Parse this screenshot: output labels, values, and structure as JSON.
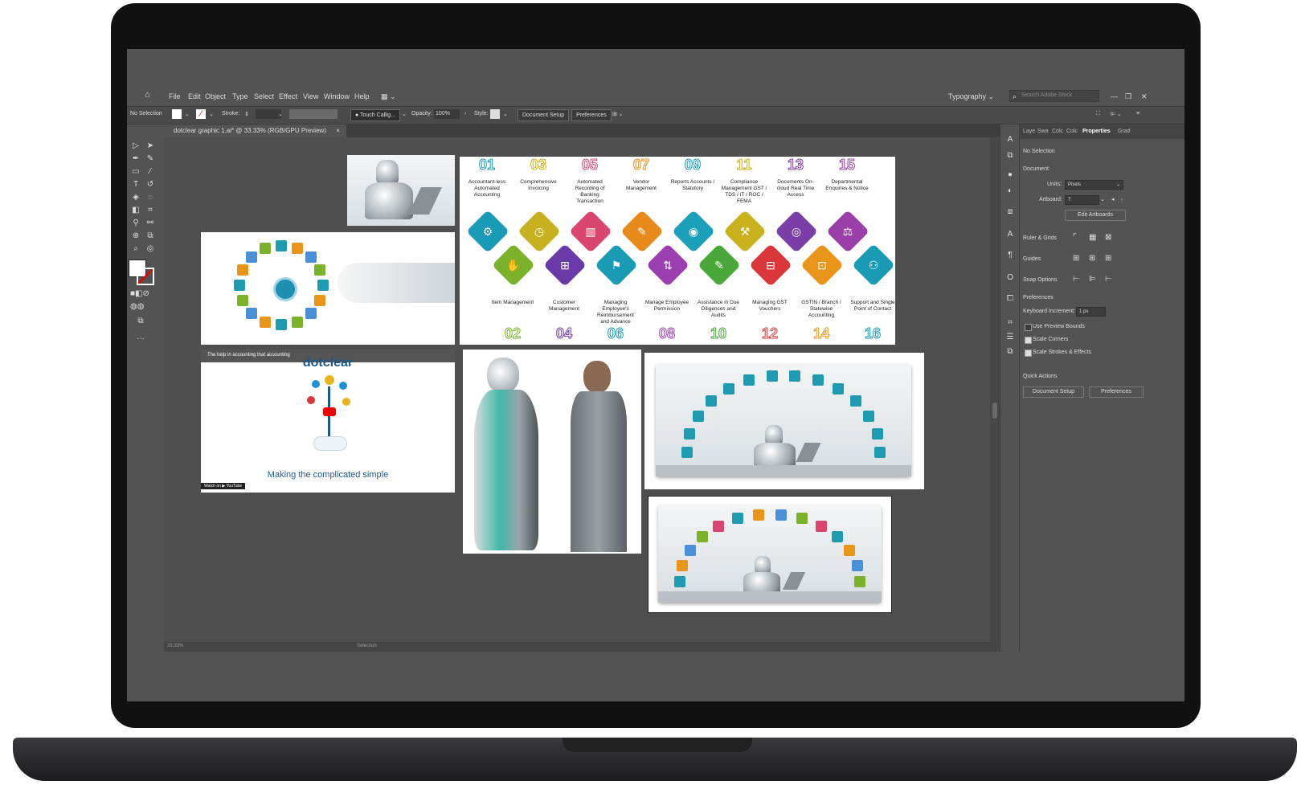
{
  "app": {
    "logo": "Ai",
    "menu": [
      "File",
      "Edit",
      "Object",
      "Type",
      "Select",
      "Effect",
      "View",
      "Window",
      "Help"
    ],
    "workspace": "Typography",
    "search_placeholder": "Search Adobe Stock"
  },
  "control_bar": {
    "selection": "No Selection",
    "stroke_label": "Stroke:",
    "brush": "Touch Callig...",
    "opacity_label": "Opacity:",
    "opacity_value": "100%",
    "style_label": "Style:",
    "document_setup": "Document Setup",
    "preferences": "Preferences"
  },
  "document_tab": {
    "title": "dotclear graphic 1.ai* @ 33.33% (RGB/GPU Preview)",
    "close": "×"
  },
  "panel": {
    "tabs": [
      "Laye",
      "Swa",
      "Colc",
      "Colc",
      "Properties",
      "Grad"
    ],
    "active_tab": "Properties",
    "no_selection": "No Selection",
    "document_heading": "Document",
    "units_label": "Units:",
    "units_value": "Pixels",
    "artboard_label": "Artboard:",
    "artboard_value": "7",
    "edit_artboards": "Edit Artboards",
    "ruler_grids": "Ruler & Grids",
    "guides": "Guides",
    "snap_options": "Snap Options",
    "preferences_heading": "Preferences",
    "keyboard_increment_label": "Keyboard Increment:",
    "keyboard_increment_value": "1 px",
    "use_preview_bounds": "Use Preview Bounds",
    "scale_corners": "Scale Corners",
    "scale_strokes": "Scale Strokes & Effects",
    "quick_actions": "Quick Actions",
    "qa_document_setup": "Document Setup",
    "qa_preferences": "Preferences"
  },
  "infographic": {
    "top": [
      {
        "num": "01",
        "text": "Accountant-less Automated Accounting",
        "color": "#1a9bb5"
      },
      {
        "num": "03",
        "text": "Comprehensive Invoicing",
        "color": "#c7b11f"
      },
      {
        "num": "05",
        "text": "Automated Recording of Banking Transaction",
        "color": "#d9456f"
      },
      {
        "num": "07",
        "text": "Vendor Management",
        "color": "#e88a1a"
      },
      {
        "num": "09",
        "text": "Reports Accounts / Statutory",
        "color": "#1aa0b8"
      },
      {
        "num": "11",
        "text": "Compliance Management GST / TDS / IT / ROC / FEMA",
        "color": "#c9b21e"
      },
      {
        "num": "13",
        "text": "Documents On-cloud Real Time Access",
        "color": "#7b3ea8"
      },
      {
        "num": "15",
        "text": "Departmental Enquiries & Notice",
        "color": "#9b3fa8"
      }
    ],
    "bottom": [
      {
        "num": "02",
        "text": "Item Management",
        "color": "#7bb22a"
      },
      {
        "num": "04",
        "text": "Customer Management",
        "color": "#6a3ba8"
      },
      {
        "num": "06",
        "text": "Managing Employee's Reimbursement and Advance",
        "color": "#1a9bb5"
      },
      {
        "num": "08",
        "text": "Manage Employee Permission",
        "color": "#9b3fb0"
      },
      {
        "num": "10",
        "text": "Assistance in Due Diligences and Audits",
        "color": "#4aa83a"
      },
      {
        "num": "12",
        "text": "Managing GST Vouchers",
        "color": "#d9373a"
      },
      {
        "num": "14",
        "text": "GSTIN / Branch / Statewise Accounting",
        "color": "#e8951a"
      },
      {
        "num": "16",
        "text": "Support and Single Point of Contact",
        "color": "#1a9bb5"
      }
    ]
  },
  "video": {
    "title": "The help in accounting that accounting",
    "brand": "dotclear",
    "tagline": "Making the complicated simple",
    "watch_on": "Watch on ▶ YouTube"
  },
  "status": {
    "zoom": "33.33%",
    "tool": "Selection"
  }
}
